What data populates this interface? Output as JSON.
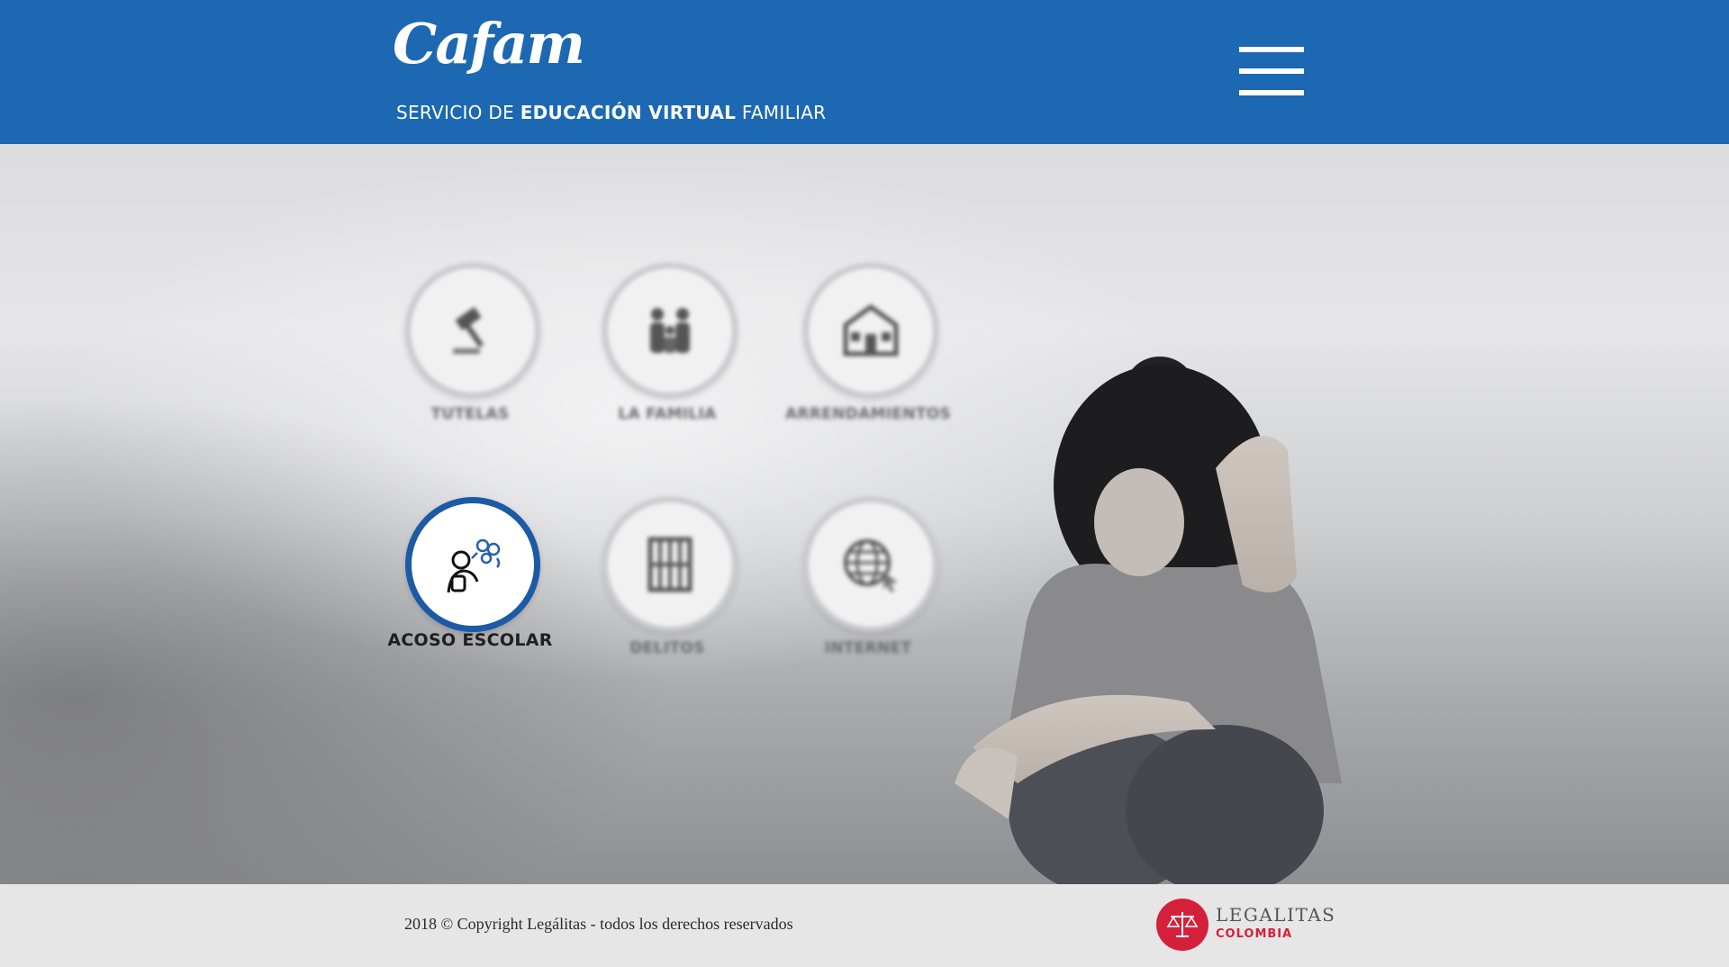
{
  "header": {
    "logo_text": "Cafam",
    "tagline_pre": "SERVICIO DE",
    "tagline_bold": "EDUCACIÓN VIRTUAL",
    "tagline_post": "FAMILIAR",
    "menu_icon": "hamburger-menu-icon",
    "brand_color": "#1c68b3"
  },
  "topics": [
    {
      "label": "TUTELAS",
      "icon": "gavel-icon",
      "active": false
    },
    {
      "label": "LA FAMILIA",
      "icon": "family-icon",
      "active": false
    },
    {
      "label": "ARRENDAMIENTOS",
      "icon": "house-icon",
      "active": false
    },
    {
      "label": "ACOSO ESCOLAR",
      "icon": "bullying-icon",
      "active": true
    },
    {
      "label": "DELITOS",
      "icon": "jail-bars-icon",
      "active": false
    },
    {
      "label": "INTERNET",
      "icon": "globe-cursor-icon",
      "active": false
    }
  ],
  "footer": {
    "copyright": "2018 © Copyright Legálitas - todos los derechos reservados",
    "brand_name": "LEGALITAS",
    "brand_country": "COLOMBIA",
    "brand_color": "#d5203b"
  }
}
